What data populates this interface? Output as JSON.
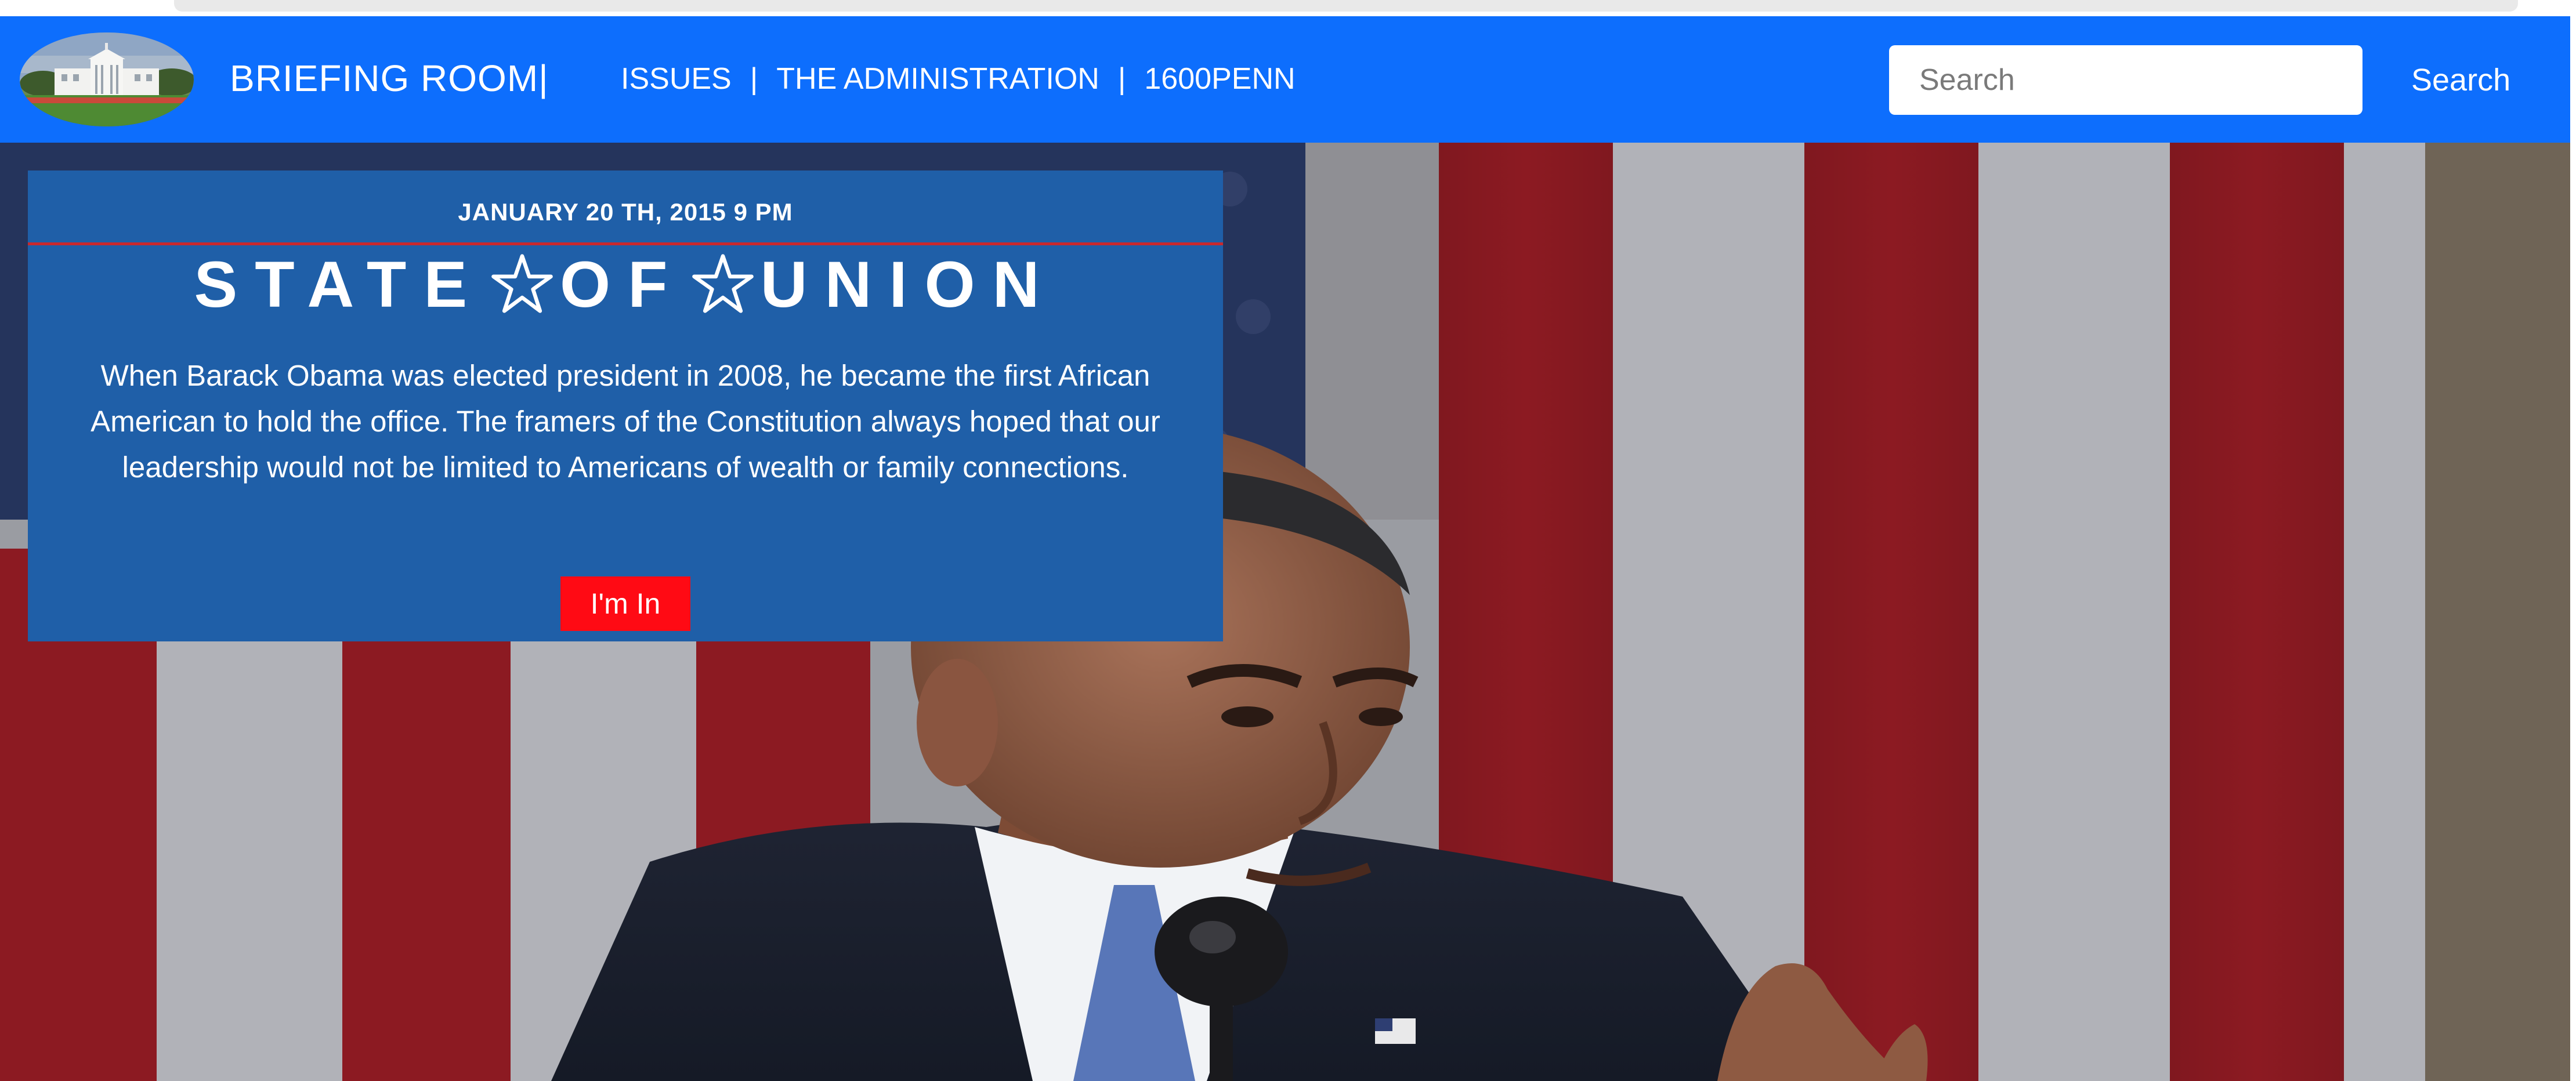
{
  "navbar": {
    "brand": "BRIEFING ROOM|",
    "links": [
      {
        "label": "ISSUES"
      },
      {
        "label": "THE ADMINISTRATION"
      },
      {
        "label": "1600PENN"
      }
    ],
    "separator": "|",
    "search": {
      "placeholder": "Search",
      "value": "",
      "button_label": "Search"
    },
    "logo_icon": "white-house-icon"
  },
  "hero": {
    "image_icon": "president-speech-photo",
    "card": {
      "date": "JANUARY 20 TH, 2015 9 PM",
      "title_words": [
        "STATE",
        "OF",
        "UNION"
      ],
      "star_icon": "star-outline-icon",
      "body": "When Barack Obama was elected president in 2008, he became the first African American to hold the office. The framers of the Constitution always hoped that our leadership would not be limited to Americans of wealth or family connections.",
      "cta_label": "I'm In"
    }
  },
  "colors": {
    "navbar": "#0d6efd",
    "card": "#1f5fa8",
    "card_rule": "#c9282d",
    "cta": "#ff0a14"
  }
}
